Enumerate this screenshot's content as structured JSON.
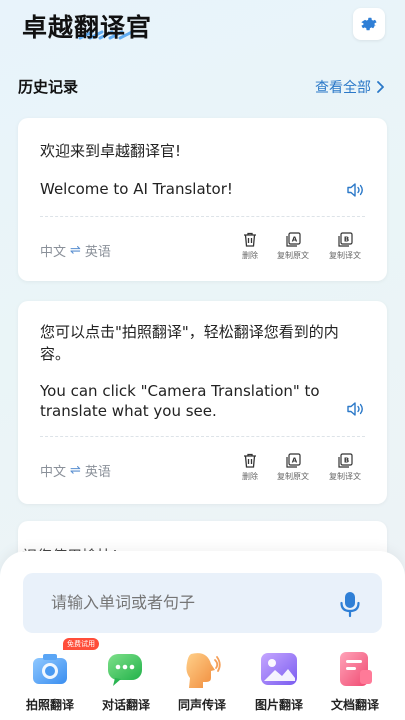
{
  "header": {
    "app_title": "卓越翻译官"
  },
  "history": {
    "title": "历史记录",
    "view_all": "查看全部"
  },
  "records": [
    {
      "source": "欢迎来到卓越翻译官!",
      "target": "Welcome to AI Translator!",
      "from_lang": "中文",
      "to_lang": "英语",
      "actions": [
        "删除",
        "复制原文",
        "复制译文"
      ]
    },
    {
      "source_line1": "您可以点击\"拍照翻译\"，轻松翻译您看到的内",
      "source_line2": "容。",
      "target_line1": "You can click \"Camera Translation\" to",
      "target_line2": "translate what you see.",
      "from_lang": "中文",
      "to_lang": "英语",
      "actions": [
        "删除",
        "复制原文",
        "复制译文"
      ]
    }
  ],
  "third_card_peek": "祝您使用愉快!",
  "input": {
    "placeholder": "请输入单词或者句子"
  },
  "tools": [
    {
      "label": "拍照翻译",
      "icon": "camera-icon",
      "badge": "免费试用"
    },
    {
      "label": "对话翻译",
      "icon": "chat-icon"
    },
    {
      "label": "同声传译",
      "icon": "head-speaking-icon"
    },
    {
      "label": "图片翻译",
      "icon": "image-icon"
    },
    {
      "label": "文档翻译",
      "icon": "document-icon"
    }
  ],
  "colors": {
    "accent": "#2a78c8",
    "settings_gear": "#2f7fd6"
  }
}
